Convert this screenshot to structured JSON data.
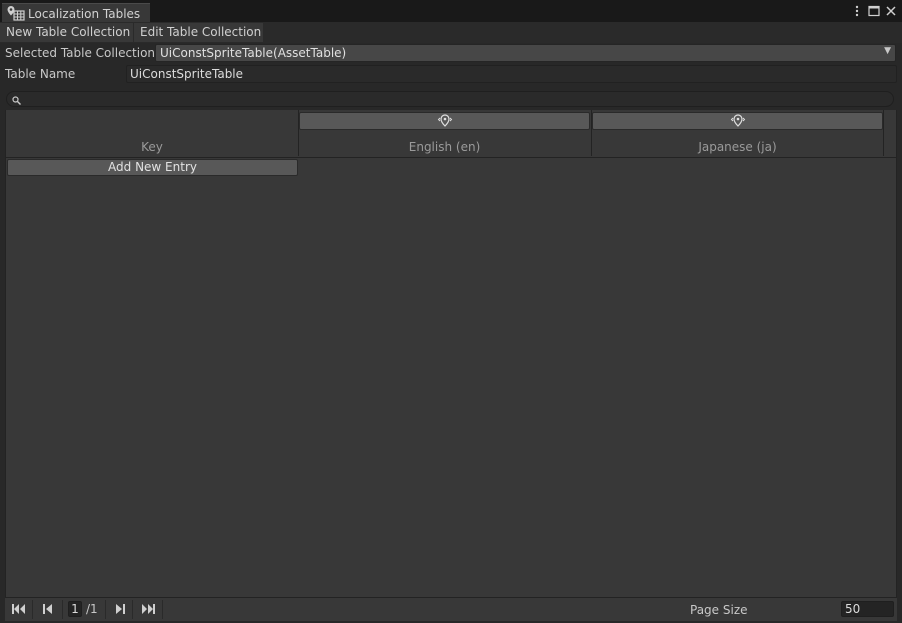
{
  "window": {
    "tab_title": "Localization Tables"
  },
  "toolbar": {
    "new_collection_label": "New Table Collection",
    "edit_collection_label": "Edit Table Collection"
  },
  "form": {
    "selected_collection_label": "Selected Table Collection",
    "selected_collection_value": "UiConstSpriteTable(AssetTable)",
    "table_name_label": "Table Name",
    "table_name_value": "UiConstSpriteTable"
  },
  "table": {
    "columns": [
      {
        "title": "Key"
      },
      {
        "title": "English (en)"
      },
      {
        "title": "Japanese (ja)"
      }
    ],
    "add_entry_label": "Add New Entry"
  },
  "pagination": {
    "current_page": "1",
    "total_pages": "/1",
    "page_size_label": "Page Size",
    "page_size_value": "50"
  },
  "icons": {
    "tab": "localization-table-icon",
    "locale": "locale-settings-icon",
    "search": "search-icon",
    "menu": "kebab-menu-icon",
    "maximize": "maximize-icon",
    "close": "close-icon"
  }
}
